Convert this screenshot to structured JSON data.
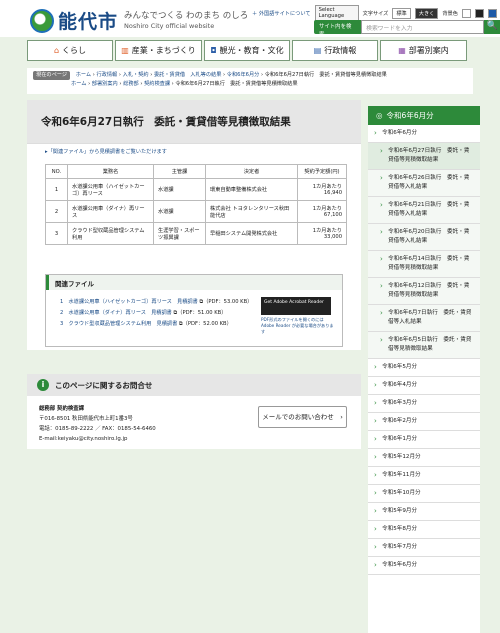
{
  "header": {
    "logo_text": "能代市",
    "tagline": "みんなでつくる わのまち のしろ",
    "tagline_en": "Noshiro City official website",
    "links": [
      "＋ 外国語サイトについて"
    ],
    "lang_select": "Select Language",
    "font_size_label": "文字サイズ",
    "font_sizes": [
      "標準",
      "大きく"
    ],
    "bg_label": "背景色",
    "search_label": "サイト内を検索",
    "search_placeholder": "検索ワードを入力",
    "search_button": "🔍"
  },
  "gnav": [
    {
      "label": "くらし",
      "icon": "house-icon"
    },
    {
      "label": "産業・まちづくり",
      "icon": "factory-icon"
    },
    {
      "label": "観光・教育・文化",
      "icon": "camera-icon"
    },
    {
      "label": "行政情報",
      "icon": "document-icon"
    },
    {
      "label": "部署別案内",
      "icon": "building-icon"
    }
  ],
  "breadcrumb": {
    "label": "現在のページ",
    "line1": [
      "ホーム",
      "行政情報",
      "入札・契約",
      "委託・賃貸借　入札等の結果",
      "令和6年6月分",
      "令和6年6月27日執行　委託・賃貸借等見積徴取結果"
    ],
    "line2": [
      "ホーム",
      "部署別案内",
      "総務部",
      "契約検査課",
      "令和6年6月27日執行　委託・賃貸借等見積徴取結果"
    ]
  },
  "main": {
    "title": "令和6年6月27日執行　委託・賃貸借等見積徴取結果",
    "dl_prefix": "▸「関連ファイル」",
    "dl_text": "から見積調書をご覧いただけます",
    "table": {
      "headers": [
        "NO.",
        "業務名",
        "主管課",
        "決定者",
        "契約予定額(円)"
      ],
      "rows": [
        [
          "1",
          "水道課公用車（ハイゼットカーゴ）再リース",
          "水道課",
          "環東自動車整備株式会社",
          "1カ月あたり 16,940"
        ],
        [
          "2",
          "水道課公用車（ダイナ）再リース",
          "水道課",
          "株式会社 トヨタレンタリース秋田 能代店",
          "1カ月あたり 67,100"
        ],
        [
          "3",
          "クラウド型収蔵品管理システム利用",
          "生涯学習・スポーツ振興課",
          "早稲田システム開発株式会社",
          "1カ月あたり 33,000"
        ]
      ]
    },
    "files": {
      "heading": "関連ファイル",
      "items": [
        {
          "text": "1　水道課公用車（ハイゼットカーゴ）再リース　見積調書",
          "meta": "（PDF：53.00 KB）"
        },
        {
          "text": "2　水道課公用車（ダイナ）再リース　見積調書",
          "meta": "（PDF：51.00 KB）"
        },
        {
          "text": "3　クラウド型収蔵品管理システム利用　見積調書",
          "meta": "（PDF：52.00 KB）"
        }
      ],
      "adobe": "Get Adobe Acrobat Reader",
      "adobe_note": "PDF形式のファイルを開くのには Adobe Reader が必要な場合があります"
    }
  },
  "contact": {
    "heading": "このページに関するお問合せ",
    "dept": "総務部 契約検査課",
    "address": "〒016-8501 秋田県能代市上町1番3号",
    "phone": "電話：0185-89-2222 ／ FAX：0185-54-6460",
    "email": "E-mail:keiyaku@city.noshiro.lg.jp",
    "button": "メールでのお問い合わせ　›"
  },
  "sidebar": {
    "heading": "令和6年6月分",
    "items": [
      {
        "label": "令和6年6月分",
        "sub": false
      },
      {
        "label": "令和6年6月27日執行　委託・賃貸借等見積徴取結果",
        "sub": true,
        "active": true
      },
      {
        "label": "令和6年6月26日執行　委託・賃貸借等入札結果",
        "sub": true
      },
      {
        "label": "令和6年6月21日執行　委託・賃貸借等入札結果",
        "sub": true
      },
      {
        "label": "令和6年6月20日執行　委託・賃貸借等入札結果",
        "sub": true
      },
      {
        "label": "令和6年6月14日執行　委託・賃貸借等見積徴取結果",
        "sub": true
      },
      {
        "label": "令和6年6月12日執行　委託・賃貸借等見積徴取結果",
        "sub": true
      },
      {
        "label": "令和6年6月7日執行　委託・賃貸借等入札結果",
        "sub": true
      },
      {
        "label": "令和6年6月5日執行　委託・賃貸借等見積徴取結果",
        "sub": true
      },
      {
        "label": "令和6年5月分",
        "sub": false
      },
      {
        "label": "令和6年4月分",
        "sub": false
      },
      {
        "label": "令和6年3月分",
        "sub": false
      },
      {
        "label": "令和6年2月分",
        "sub": false
      },
      {
        "label": "令和6年1月分",
        "sub": false
      },
      {
        "label": "令和5年12月分",
        "sub": false
      },
      {
        "label": "令和5年11月分",
        "sub": false
      },
      {
        "label": "令和5年10月分",
        "sub": false
      },
      {
        "label": "令和5年9月分",
        "sub": false
      },
      {
        "label": "令和5年8月分",
        "sub": false
      },
      {
        "label": "令和5年7月分",
        "sub": false
      },
      {
        "label": "令和5年6月分",
        "sub": false
      }
    ]
  },
  "colors": {
    "accent": "#2d8a3a",
    "link": "#1a4b86",
    "nav_icon": "#e0602a"
  }
}
